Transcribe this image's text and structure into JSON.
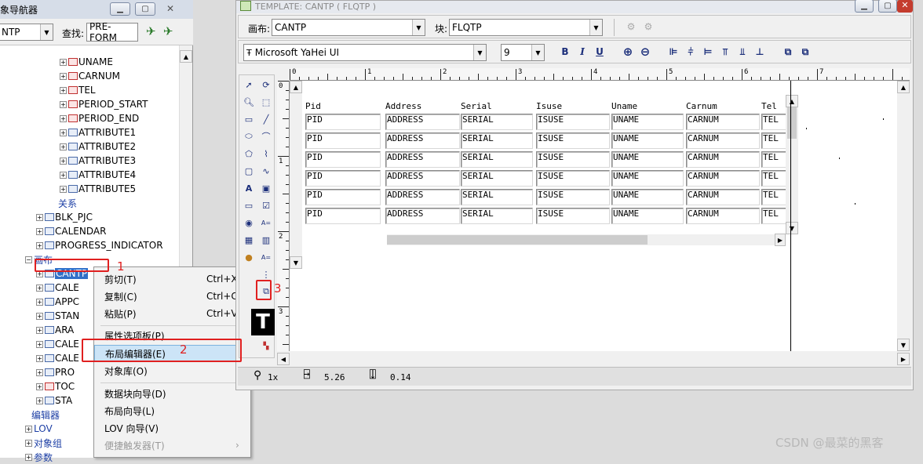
{
  "navigator": {
    "title": "象导航器",
    "module_value": "NTP",
    "find_label": "查找:",
    "find_value": "PRE-FORM",
    "tree": [
      {
        "label": "UNAME",
        "icon": "text-item-icon"
      },
      {
        "label": "CARNUM",
        "icon": "text-item-icon"
      },
      {
        "label": "TEL",
        "icon": "text-item-icon"
      },
      {
        "label": "PERIOD_START",
        "icon": "text-item-icon"
      },
      {
        "label": "PERIOD_END",
        "icon": "text-item-icon"
      },
      {
        "label": "ATTRIBUTE1",
        "icon": "display-item-icon"
      },
      {
        "label": "ATTRIBUTE2",
        "icon": "display-item-icon"
      },
      {
        "label": "ATTRIBUTE3",
        "icon": "display-item-icon"
      },
      {
        "label": "ATTRIBUTE4",
        "icon": "display-item-icon"
      },
      {
        "label": "ATTRIBUTE5",
        "icon": "display-item-icon"
      },
      {
        "label": "关系",
        "icon": ""
      },
      {
        "label": "BLK_PJC",
        "icon": "block-icon"
      },
      {
        "label": "CALENDAR",
        "icon": "block-icon"
      },
      {
        "label": "PROGRESS_INDICATOR",
        "icon": "block-icon"
      },
      {
        "label": "画布",
        "icon": ""
      },
      {
        "label": "CANTP",
        "icon": "canvas-icon"
      },
      {
        "label": "CALE",
        "icon": "canvas-icon"
      },
      {
        "label": "APPC",
        "icon": "canvas-icon"
      },
      {
        "label": "STAN",
        "icon": "canvas-icon"
      },
      {
        "label": "ARA",
        "icon": "canvas-icon"
      },
      {
        "label": "CALE",
        "icon": "canvas-icon"
      },
      {
        "label": "CALE",
        "icon": "canvas-icon"
      },
      {
        "label": "PRO",
        "icon": "canvas-icon"
      },
      {
        "label": "TOC",
        "icon": "canvas-icon"
      },
      {
        "label": "STA",
        "icon": "canvas-icon"
      },
      {
        "label": "编辑器",
        "icon": ""
      },
      {
        "label": "LOV",
        "icon": ""
      },
      {
        "label": "对象组",
        "icon": ""
      },
      {
        "label": "参数",
        "icon": ""
      }
    ]
  },
  "context_menu": {
    "items": [
      {
        "label": "剪切(T)",
        "shortcut": "Ctrl+X"
      },
      {
        "label": "复制(C)",
        "shortcut": "Ctrl+C"
      },
      {
        "label": "粘贴(P)",
        "shortcut": "Ctrl+V"
      },
      {
        "label": "属性选项板(P)",
        "shortcut": ""
      },
      {
        "label": "布局编辑器(E)",
        "shortcut": ""
      },
      {
        "label": "对象库(O)",
        "shortcut": ""
      },
      {
        "label": "数据块向导(D)",
        "shortcut": ""
      },
      {
        "label": "布局向导(L)",
        "shortcut": ""
      },
      {
        "label": "LOV 向导(V)",
        "shortcut": ""
      },
      {
        "label": "便捷触发器(T)",
        "shortcut": "›"
      }
    ]
  },
  "annotations": [
    "1",
    "2",
    "3"
  ],
  "editor": {
    "title": "TEMPLATE: CANTP ( FLQTP )",
    "canvas_label": "画布:",
    "canvas_value": "CANTP",
    "block_label": "块:",
    "block_value": "FLQTP",
    "font_value": "Microsoft YaHei UI",
    "font_size": "9",
    "ruler_ticks": [
      "0",
      "1",
      "2",
      "3",
      "4",
      "5",
      "6",
      "7"
    ],
    "vruler_ticks": [
      "0",
      "1",
      "2",
      "3"
    ],
    "columns": [
      "Pid",
      "Address",
      "Serial",
      "Isuse",
      "Uname",
      "Carnum",
      "Tel"
    ],
    "cells": [
      "PID",
      "ADDRESS",
      "SERIAL",
      "ISUSE",
      "UNAME",
      "CARNUM",
      "TEL"
    ],
    "status": {
      "zoom": "1x",
      "pos_x": "5.26",
      "pos_y": "0.14"
    }
  },
  "watermark": "CSDN @最菜的黑客"
}
